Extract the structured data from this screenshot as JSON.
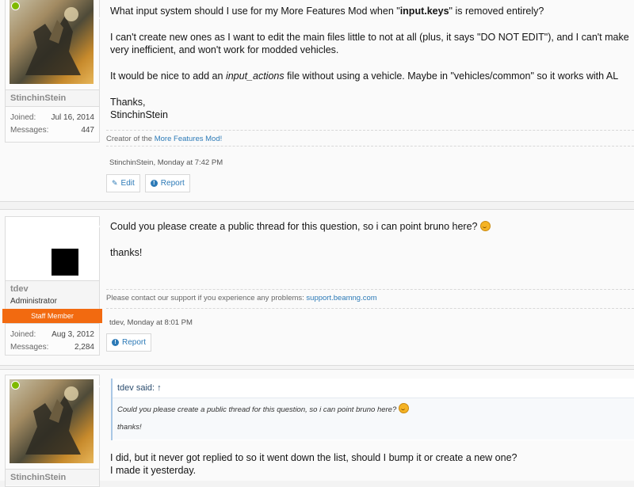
{
  "posts": [
    {
      "author": "StinchinStein",
      "stats": {
        "joined_label": "Joined:",
        "joined": "Jul 16, 2014",
        "messages_label": "Messages:",
        "messages": "447"
      },
      "paragraphs": {
        "q_pre": "What input system should I use for my More Features Mod when \"",
        "q_bold": "input.keys",
        "q_post": "\" is removed entirely?",
        "p2a": "I can't create new ones as I want to edit the main files little to not at all (plus, it says \"DO NOT EDIT\"), and I can't make",
        "p2b": "very inefficient, and won't work for modded vehicles.",
        "p3_pre": "It would be nice to add an ",
        "p3_ital": "input_actions",
        "p3_post": " file without using a vehicle. Maybe in \"vehicles/common\" so it works with AL",
        "thanks": "Thanks,",
        "sign": "StinchinStein"
      },
      "signature_pre": "Creator of the ",
      "signature_link": "More Features Mod!",
      "meta": "StinchinStein, Monday at 7:42 PM",
      "buttons": {
        "edit": "Edit",
        "report": "Report"
      }
    },
    {
      "author": "tdev",
      "user_title": "Administrator",
      "banner": "Staff Member",
      "stats": {
        "joined_label": "Joined:",
        "joined": "Aug 3, 2012",
        "messages_label": "Messages:",
        "messages": "2,284"
      },
      "line1": "Could you please create a public thread for this question, so i can point bruno here?",
      "line2": "thanks!",
      "signature_pre": "Please contact our support if you experience any problems: ",
      "signature_link": "support.beamng.com",
      "meta": "tdev, Monday at 8:01 PM",
      "buttons": {
        "report": "Report"
      }
    },
    {
      "author": "StinchinStein",
      "quote": {
        "head": "tdev said: ↑",
        "line1": "Could you please create a public thread for this question, so i can point bruno here?",
        "line2": "thanks!"
      },
      "line1": "I did, but it never got replied to so it went down the list, should I bump it or create a new one?",
      "line2": "I made it yesterday."
    }
  ]
}
